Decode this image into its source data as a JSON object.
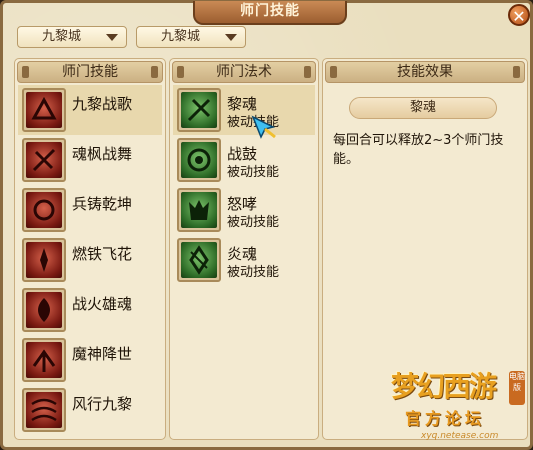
{
  "window": {
    "title": "师门技能",
    "close_icon": "close-icon",
    "accent_color": "#b34a12"
  },
  "filters": {
    "dropdown_1": "九黎城",
    "dropdown_2": "九黎城"
  },
  "skills_panel": {
    "header": "师门技能",
    "items": [
      {
        "label": "九黎战歌",
        "icon": "skill-icon",
        "selected": true
      },
      {
        "label": "魂枫战舞",
        "icon": "skill-icon"
      },
      {
        "label": "兵铸乾坤",
        "icon": "skill-icon"
      },
      {
        "label": "燃铁飞花",
        "icon": "skill-icon"
      },
      {
        "label": "战火雄魂",
        "icon": "skill-icon"
      },
      {
        "label": "魔神降世",
        "icon": "skill-icon"
      },
      {
        "label": "风行九黎",
        "icon": "skill-icon"
      }
    ]
  },
  "arts_panel": {
    "header": "师门法术",
    "items": [
      {
        "label": "黎魂",
        "type": "被动技能",
        "selected": true
      },
      {
        "label": "战鼓",
        "type": "被动技能"
      },
      {
        "label": "怒哮",
        "type": "被动技能"
      },
      {
        "label": "炎魂",
        "type": "被动技能"
      }
    ]
  },
  "effect_panel": {
    "header": "技能效果",
    "skill_name": "黎魂",
    "description": "每回合可以释放2~3个师门技能。"
  },
  "watermark": {
    "logo_text": "梦幻西游",
    "badge": "电脑版",
    "subtitle": "官方论坛",
    "url": "xyq.netease.com"
  }
}
